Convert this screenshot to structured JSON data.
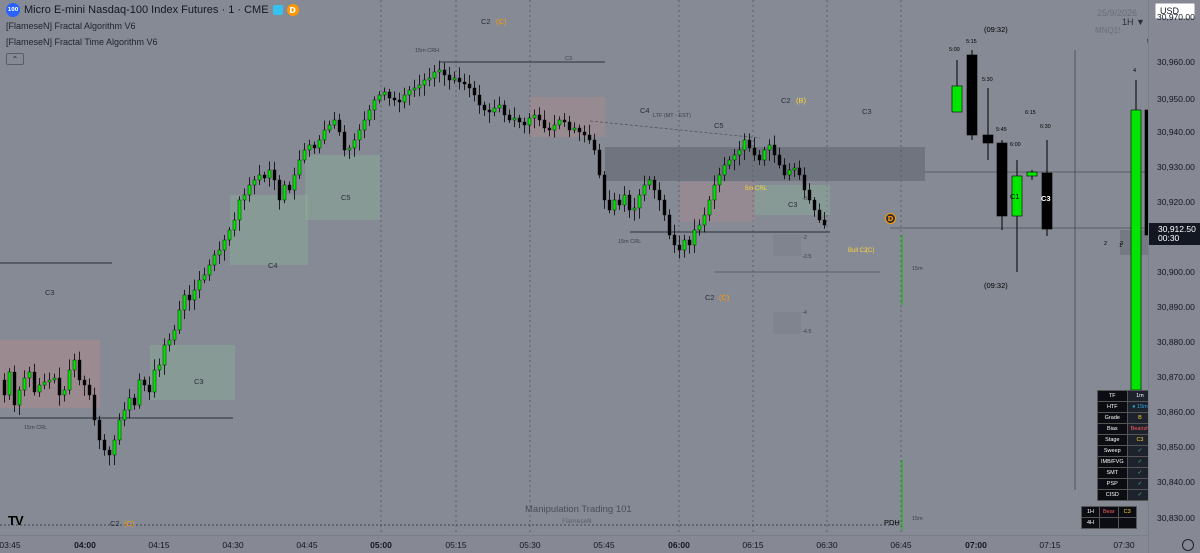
{
  "header": {
    "logo_text": "100",
    "title": "Micro E-mini Nasdaq-100 Index Futures · 1 · CME",
    "badge_letter": "D"
  },
  "indicators": [
    "[FlameseN] Fractal Algorithm V6",
    "[FlameseN] Fractal Time Algorithm V6"
  ],
  "collapse_icon": "chevron-up-icon",
  "currency": "USD",
  "top_right": {
    "date": "25/9/2026",
    "timeframe": "1H ▼",
    "ticker": "MNQ1!"
  },
  "price_scale": {
    "ticks": [
      "30,970.00",
      "30,960.00",
      "30,950.00",
      "30,940.00",
      "30,930.00",
      "30,920.00",
      "30,900.00",
      "30,890.00",
      "30,880.00",
      "30,870.00",
      "30,860.00",
      "30,850.00",
      "30,840.00",
      "30,830.00"
    ],
    "current_price": "30,912.50",
    "countdown": "00:30"
  },
  "time_scale": {
    "ticks": [
      {
        "label": "03:45",
        "bold": false
      },
      {
        "label": "04:00",
        "bold": true
      },
      {
        "label": "04:15",
        "bold": false
      },
      {
        "label": "04:30",
        "bold": false
      },
      {
        "label": "04:45",
        "bold": false
      },
      {
        "label": "05:00",
        "bold": true
      },
      {
        "label": "05:15",
        "bold": false
      },
      {
        "label": "05:30",
        "bold": false
      },
      {
        "label": "05:45",
        "bold": false
      },
      {
        "label": "06:00",
        "bold": true
      },
      {
        "label": "06:15",
        "bold": false
      },
      {
        "label": "06:30",
        "bold": false
      },
      {
        "label": "06:45",
        "bold": false
      },
      {
        "label": "07:00",
        "bold": true
      },
      {
        "label": "07:15",
        "bold": false
      },
      {
        "label": "07:30",
        "bold": false
      }
    ]
  },
  "chart_labels": {
    "c2_top": "C2",
    "c2_top_tag": "(C)",
    "c3_top": "C3",
    "m15_crh": "15m CRH",
    "c4_mid": "C4",
    "ltf": "LTF (MT - EST)",
    "c5_mid": "C5",
    "c2_b": "C2",
    "c2_b_tag": "(B)",
    "c3_right": "C3",
    "c5_left": "C5",
    "c4_left": "C4",
    "c3_left": "C3",
    "c3_lower": "C3",
    "m15_crl_left": "15m CRL",
    "m15_crl_mid": "15m CRL",
    "m5_crl": "5m CRL",
    "c3_box": "C3",
    "c2_lower": "C2",
    "c2_lower_tag": "(C)",
    "c2_bottom": "C2",
    "c2_bottom_tag": "(C)",
    "bull_c2": "Bull C2",
    "bull_c2_tag": "(C)",
    "m15_right": "15m",
    "m15_bottom": "15m",
    "pdh": "PDH",
    "d_badge": "D",
    "t500": "5:00",
    "t515": "5:15",
    "t530": "5:30",
    "t545": "5:45",
    "t600": "6:00",
    "t615": "6:15",
    "t630": "6:30",
    "time_0932_top": "(09:32)",
    "time_0932_bottom": "(09:32)",
    "c1_htf": "C1",
    "c3_htf": "C3",
    "n1": "1",
    "n2": "2",
    "n3": "3",
    "n4": "4",
    "n5": "5",
    "lvl_a": "-2",
    "lvl_b": "-2.5",
    "lvl_c": "-4",
    "lvl_d": "-4.5",
    "lvl_e": "-3"
  },
  "watermark": {
    "title": "Manipulation Trading 101",
    "sub": "FlameseN"
  },
  "status_table": [
    {
      "k": "TF",
      "v": "1m",
      "cls": ""
    },
    {
      "k": "HTF",
      "v": "● 15m",
      "cls": "blu"
    },
    {
      "k": "Grade",
      "v": "B",
      "cls": "ylw"
    },
    {
      "k": "Bias",
      "v": "Bearish",
      "cls": "red"
    },
    {
      "k": "Stage",
      "v": "C3",
      "cls": "ylw"
    },
    {
      "k": "Sweep",
      "v": "✓",
      "cls": "grn"
    },
    {
      "k": "IMB/FVG",
      "v": "✓",
      "cls": "grn"
    },
    {
      "k": "SMT",
      "v": "✓",
      "cls": "grn"
    },
    {
      "k": "PSP",
      "v": "✓",
      "cls": "grn"
    },
    {
      "k": "CISD",
      "v": "✓",
      "cls": "grn"
    }
  ],
  "htf_table": [
    {
      "a": "1H",
      "b": "Bear",
      "c": "C3"
    },
    {
      "a": "4H",
      "b": "",
      "c": ""
    }
  ],
  "colors": {
    "background": "#868a94",
    "bull": "#00e600",
    "bear": "#000000",
    "accent_blue": "#2ca8e0",
    "accent_orange": "#ff9800"
  }
}
